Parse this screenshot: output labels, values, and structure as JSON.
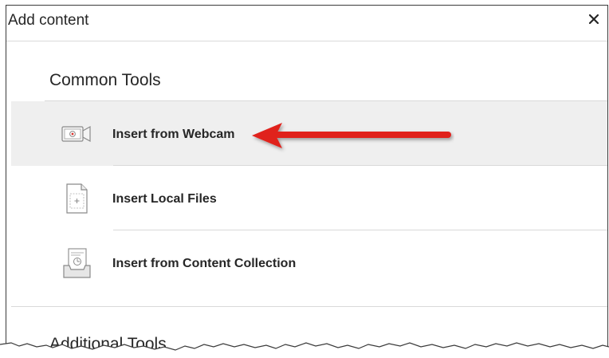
{
  "dialog": {
    "title": "Add content",
    "close_label": "×"
  },
  "sections": {
    "common": {
      "heading": "Common Tools"
    },
    "additional": {
      "heading": "Additional Tools"
    }
  },
  "tools": [
    {
      "label": "Insert from Webcam",
      "icon": "webcam-icon",
      "highlighted": true
    },
    {
      "label": "Insert Local Files",
      "icon": "local-file-icon",
      "highlighted": false
    },
    {
      "label": "Insert from Content Collection",
      "icon": "content-collection-icon",
      "highlighted": false
    }
  ],
  "annotation": {
    "arrow_color": "#e0201b",
    "points_to": "Insert from Webcam"
  },
  "colors": {
    "highlight_bg": "#efefef",
    "divider": "#d9d9d9",
    "text": "#262626"
  }
}
